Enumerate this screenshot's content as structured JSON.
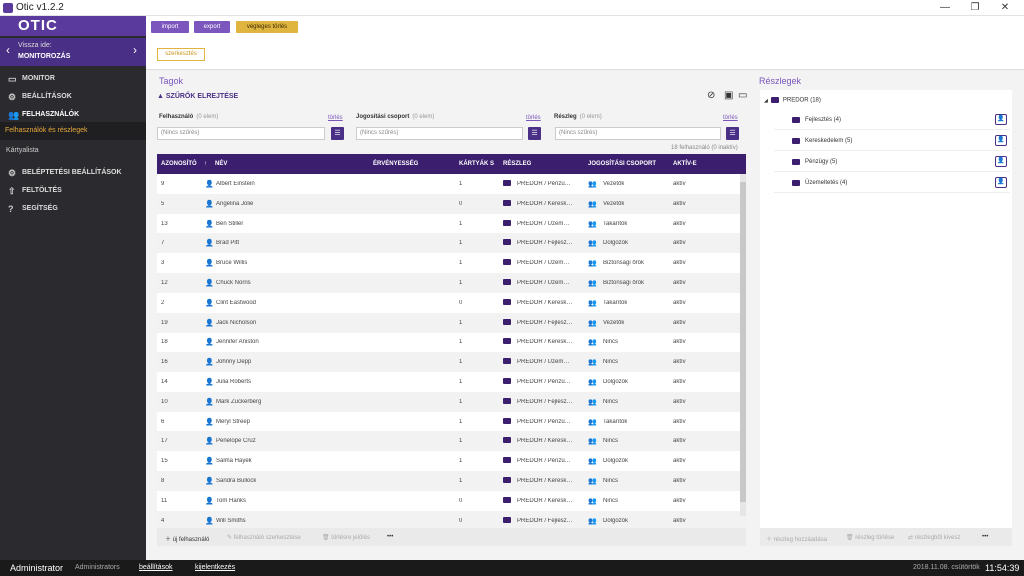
{
  "window": {
    "title": "Otic v1.2.2",
    "min": "—",
    "max": "❐",
    "close": "✕"
  },
  "sidebar": {
    "logo": "OTIC",
    "back_label": "Vissza ide:",
    "back_target": "MONITOROZÁS",
    "items": [
      {
        "label": "MONITOR",
        "icon": "monitor-icon"
      },
      {
        "label": "BEÁLLÍTÁSOK",
        "icon": "gear-icon"
      },
      {
        "label": "FELHASZNÁLÓK",
        "icon": "users-icon"
      },
      {
        "label": "Felhasználók és részlegek",
        "icon": "chevron-right-icon"
      },
      {
        "label": "Kártyalista",
        "icon": ""
      },
      {
        "label": "BELÉPTETÉSI BEÁLLÍTÁSOK",
        "icon": "gear-icon"
      },
      {
        "label": "FELTÖLTÉS",
        "icon": "upload-icon"
      },
      {
        "label": "SEGÍTSÉG",
        "icon": "help-icon"
      }
    ]
  },
  "topbar": {
    "import": "import",
    "export": "export",
    "delete": "végleges törlés"
  },
  "toolbar": {
    "edit": "szerkesztés"
  },
  "members": {
    "title": "Tagok",
    "filter_toggle": "SZŰRŐK ELREJTÉSE",
    "filters": [
      {
        "label": "Felhasználó",
        "count": "(0 elem)",
        "clear": "törlés",
        "placeholder": "(Nincs szűrés)"
      },
      {
        "label": "Jogosítási csoport",
        "count": "(0 elem)",
        "clear": "törlés",
        "placeholder": "(Nincs szűrés)"
      },
      {
        "label": "Részleg",
        "count": "(0 elem)",
        "clear": "törlés",
        "placeholder": "(Nincs szűrés)"
      }
    ],
    "count_text": "18 felhasználó (0 inaktív)",
    "columns": [
      "AZONOSÍTÓ",
      "NÉV",
      "ÉRVÉNYESSÉG",
      "KÁRTYÁK S",
      "RÉSZLEG",
      "JOGOSÍTÁSI CSOPORT",
      "AKTÍV-E"
    ],
    "rows": [
      {
        "id": "9",
        "name": "Albert Einstein",
        "validity": "",
        "cards": "1",
        "dept": "PREDOR / Pénzü…",
        "group": "Vezetők",
        "active": "aktív"
      },
      {
        "id": "5",
        "name": "Angelina Jolie",
        "validity": "",
        "cards": "0",
        "dept": "PREDOR / Keresk…",
        "group": "Vezetők",
        "active": "aktív"
      },
      {
        "id": "13",
        "name": "Ben Stiller",
        "validity": "",
        "cards": "1",
        "dept": "PREDOR / Üzem…",
        "group": "Takarítók",
        "active": "aktív"
      },
      {
        "id": "7",
        "name": "Brad Pitt",
        "validity": "",
        "cards": "1",
        "dept": "PREDOR / Fejlesz…",
        "group": "Dolgozók",
        "active": "aktív"
      },
      {
        "id": "3",
        "name": "Bruce Willis",
        "validity": "",
        "cards": "1",
        "dept": "PREDOR / Üzem…",
        "group": "Biztonsági őrök",
        "active": "aktív"
      },
      {
        "id": "12",
        "name": "Chuck Norris",
        "validity": "",
        "cards": "1",
        "dept": "PREDOR / Üzem…",
        "group": "Biztonsági őrök",
        "active": "aktív"
      },
      {
        "id": "2",
        "name": "Clint Eastwood",
        "validity": "",
        "cards": "0",
        "dept": "PREDOR / Keresk…",
        "group": "Takarítók",
        "active": "aktív"
      },
      {
        "id": "19",
        "name": "Jack Nicholson",
        "validity": "",
        "cards": "1",
        "dept": "PREDOR / Fejlesz…",
        "group": "Vezetők",
        "active": "aktív"
      },
      {
        "id": "18",
        "name": "Jennifer Aniston",
        "validity": "",
        "cards": "1",
        "dept": "PREDOR / Keresk…",
        "group": "Nincs",
        "active": "aktív"
      },
      {
        "id": "16",
        "name": "Johnny Depp",
        "validity": "",
        "cards": "1",
        "dept": "PREDOR / Üzem…",
        "group": "Nincs",
        "active": "aktív"
      },
      {
        "id": "14",
        "name": "Julia Roberts",
        "validity": "",
        "cards": "1",
        "dept": "PREDOR / Pénzü…",
        "group": "Dolgozók",
        "active": "aktív"
      },
      {
        "id": "10",
        "name": "Mark Zuckerberg",
        "validity": "",
        "cards": "1",
        "dept": "PREDOR / Fejlesz…",
        "group": "Nincs",
        "active": "aktív"
      },
      {
        "id": "6",
        "name": "Meryl Streep",
        "validity": "",
        "cards": "1",
        "dept": "PREDOR / Pénzü…",
        "group": "Takarítók",
        "active": "aktív"
      },
      {
        "id": "17",
        "name": "Penelope Cruz",
        "validity": "",
        "cards": "1",
        "dept": "PREDOR / Keresk…",
        "group": "Nincs",
        "active": "aktív"
      },
      {
        "id": "15",
        "name": "Salma Hayek",
        "validity": "",
        "cards": "1",
        "dept": "PREDOR / Pénzü…",
        "group": "Dolgozók",
        "active": "aktív"
      },
      {
        "id": "8",
        "name": "Sandra Bullock",
        "validity": "",
        "cards": "1",
        "dept": "PREDOR / Keresk…",
        "group": "Nincs",
        "active": "aktív"
      },
      {
        "id": "11",
        "name": "Tom Hanks",
        "validity": "",
        "cards": "0",
        "dept": "PREDOR / Keresk…",
        "group": "Nincs",
        "active": "aktív"
      },
      {
        "id": "4",
        "name": "Will Smiths",
        "validity": "",
        "cards": "0",
        "dept": "PREDOR / Fejlesz…",
        "group": "Dolgozók",
        "active": "aktív"
      }
    ],
    "footer": {
      "new_user": "új felhasználó",
      "edit_user": "felhasználó szerkesztése",
      "mark_delete": "törlésre jelölés",
      "more": "•••"
    }
  },
  "departments": {
    "title": "Részlegek",
    "root": "PREDOR (18)",
    "children": [
      {
        "name": "Fejlesztés (4)"
      },
      {
        "name": "Kereskedelem (5)"
      },
      {
        "name": "Pénzügy (5)"
      },
      {
        "name": "Üzemeltetés (4)"
      }
    ],
    "footer": {
      "add": "részleg hozzáadása",
      "delete": "részleg törlése",
      "move_out": "részlegből kivesz",
      "more": "•••"
    }
  },
  "status": {
    "user": "Administrator",
    "role": "Administrators",
    "settings": "beállítások",
    "logout": "kijelentkezés",
    "date": "2018.11.08. csütörtök",
    "time": "11:54:39"
  },
  "colors": {
    "accent": "#4a2f87",
    "header": "#3b1f6e",
    "highlight": "#e0b53f",
    "sidebar": "#2b2b2f"
  }
}
